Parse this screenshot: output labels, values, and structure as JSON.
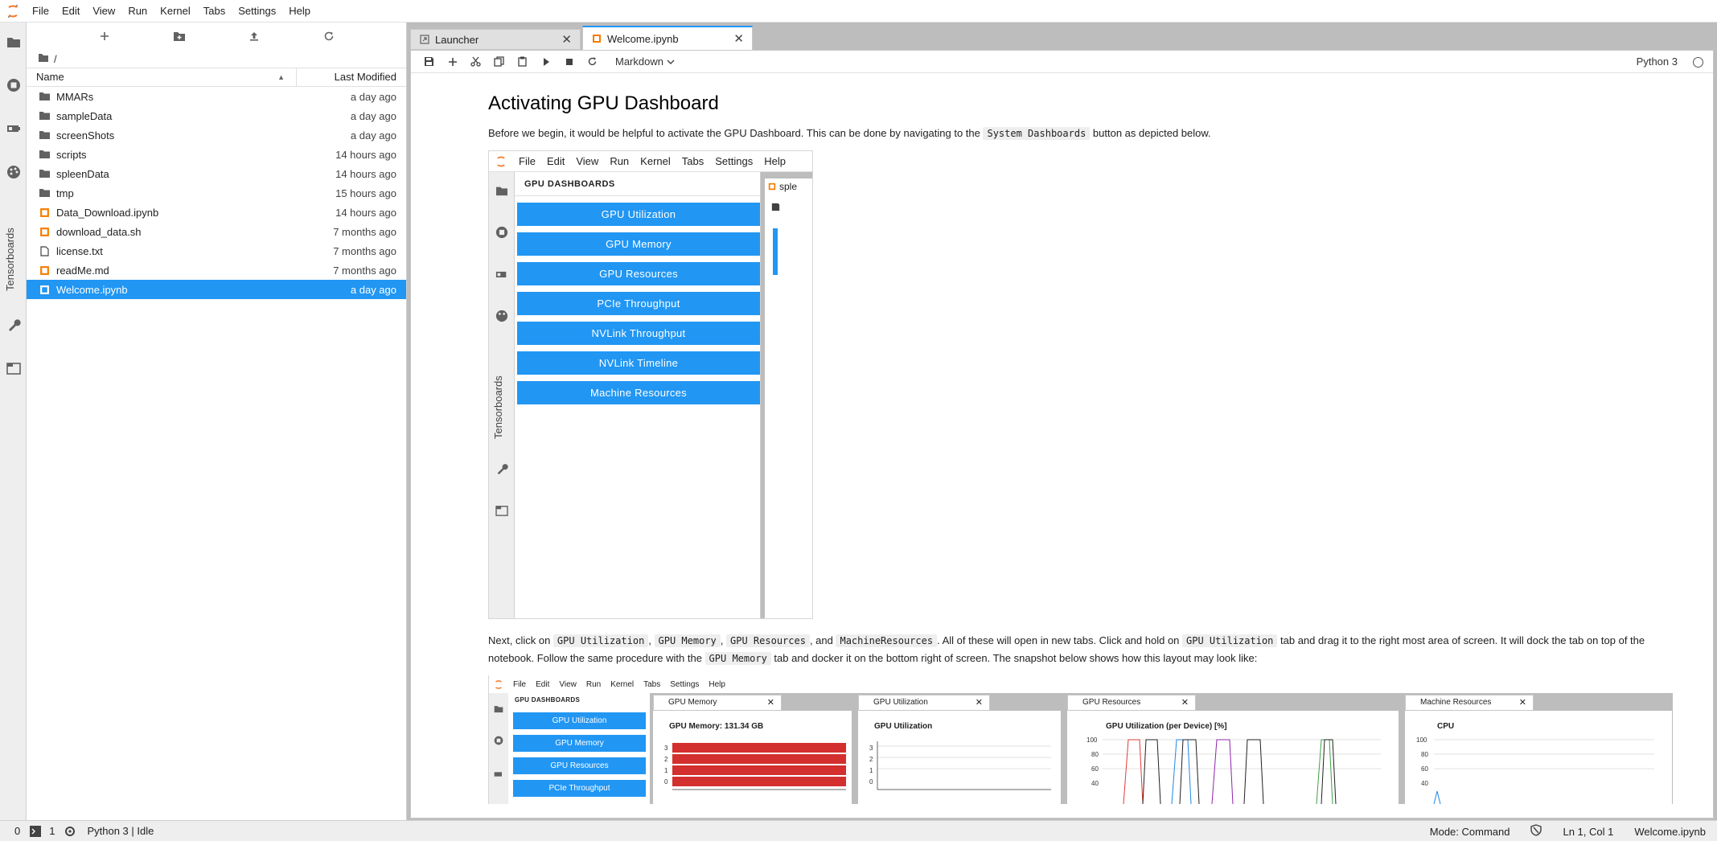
{
  "menubar": {
    "items": [
      "File",
      "Edit",
      "View",
      "Run",
      "Kernel",
      "Tabs",
      "Settings",
      "Help"
    ]
  },
  "activity": {
    "icons": [
      "folder-icon",
      "running-icon",
      "gpu-icon",
      "palette-icon",
      "wrench-icon",
      "tabs-icon"
    ],
    "tensorboards_label": "Tensorboards"
  },
  "filebrowser": {
    "path": "/",
    "columns": {
      "name": "Name",
      "modified": "Last Modified"
    },
    "files": [
      {
        "name": "MMARs",
        "type": "folder",
        "modified": "a day ago"
      },
      {
        "name": "sampleData",
        "type": "folder",
        "modified": "a day ago"
      },
      {
        "name": "screenShots",
        "type": "folder",
        "modified": "a day ago"
      },
      {
        "name": "scripts",
        "type": "folder",
        "modified": "14 hours ago"
      },
      {
        "name": "spleenData",
        "type": "folder",
        "modified": "14 hours ago"
      },
      {
        "name": "tmp",
        "type": "folder",
        "modified": "15 hours ago"
      },
      {
        "name": "Data_Download.ipynb",
        "type": "notebook",
        "modified": "14 hours ago"
      },
      {
        "name": "download_data.sh",
        "type": "notebook",
        "modified": "7 months ago"
      },
      {
        "name": "license.txt",
        "type": "file",
        "modified": "7 months ago"
      },
      {
        "name": "readMe.md",
        "type": "notebook",
        "modified": "7 months ago"
      },
      {
        "name": "Welcome.ipynb",
        "type": "notebook",
        "modified": "a day ago",
        "selected": true
      }
    ]
  },
  "tabs": [
    {
      "label": "Launcher",
      "active": false
    },
    {
      "label": "Welcome.ipynb",
      "active": true
    }
  ],
  "notebook_toolbar": {
    "cell_type": "Markdown",
    "kernel": "Python 3"
  },
  "content": {
    "heading": "Activating GPU Dashboard",
    "p1_a": "Before we begin, it would be helpful to activate the GPU Dashboard. This can be done by navigating to the ",
    "p1_code": "System Dashboards",
    "p1_b": " button as depicted below.",
    "p2_a": "Next, click on ",
    "p2_c1": "GPU Utilization",
    "p2_s1": ", ",
    "p2_c2": "GPU Memory",
    "p2_s2": ", ",
    "p2_c3": "GPU Resources",
    "p2_s3": ", and ",
    "p2_c4": "MachineResources",
    "p2_b": ". All of these will open in new tabs. Click and hold on ",
    "p2_c5": "GPU Utilization",
    "p2_c": " tab and drag it to the right most area of screen. It will dock the tab on top of the notebook. Follow the same procedure with the ",
    "p2_c6": "GPU Memory",
    "p2_d": " tab and docker it on the bottom right of screen. The snapshot below shows how this layout may look like:"
  },
  "shot1": {
    "menu": [
      "File",
      "Edit",
      "View",
      "Run",
      "Kernel",
      "Tabs",
      "Settings",
      "Help"
    ],
    "panel_title": "GPU DASHBOARDS",
    "buttons": [
      "GPU Utilization",
      "GPU Memory",
      "GPU Resources",
      "PCIe Throughput",
      "NVLink Throughput",
      "NVLink Timeline",
      "Machine Resources"
    ],
    "tensorboards_label": "Tensorboards",
    "tab_partial": "sple"
  },
  "shot2": {
    "menu": [
      "File",
      "Edit",
      "View",
      "Run",
      "Kernel",
      "Tabs",
      "Settings",
      "Help"
    ],
    "panel_title": "GPU DASHBOARDS",
    "buttons": [
      "GPU Utilization",
      "GPU Memory",
      "GPU Resources",
      "PCIe Throughput"
    ],
    "panes": [
      {
        "tab": "GPU Memory",
        "title": "GPU Memory: 131.34 GB"
      },
      {
        "tab": "GPU Utilization",
        "title": "GPU Utilization"
      },
      {
        "tab": "GPU Resources",
        "title": "GPU Utilization (per Device) [%]"
      },
      {
        "tab": "Machine Resources",
        "title": "CPU"
      }
    ],
    "mem_ticks": [
      "3",
      "2",
      "1",
      "0"
    ],
    "util_ticks": [
      "3",
      "2",
      "1",
      "0"
    ],
    "res_ticks": [
      "100",
      "80",
      "60",
      "40"
    ],
    "cpu_ticks": [
      "100",
      "80",
      "60",
      "40"
    ]
  },
  "statusbar": {
    "left_count": "0",
    "terminals": "1",
    "kernel_status": "Python 3 | Idle",
    "mode": "Mode: Command",
    "position": "Ln 1, Col 1",
    "filename": "Welcome.ipynb"
  },
  "colors": {
    "accent": "#2196f3",
    "notebook_icon": "#f57c00",
    "memory_bar": "#d32f2f"
  }
}
